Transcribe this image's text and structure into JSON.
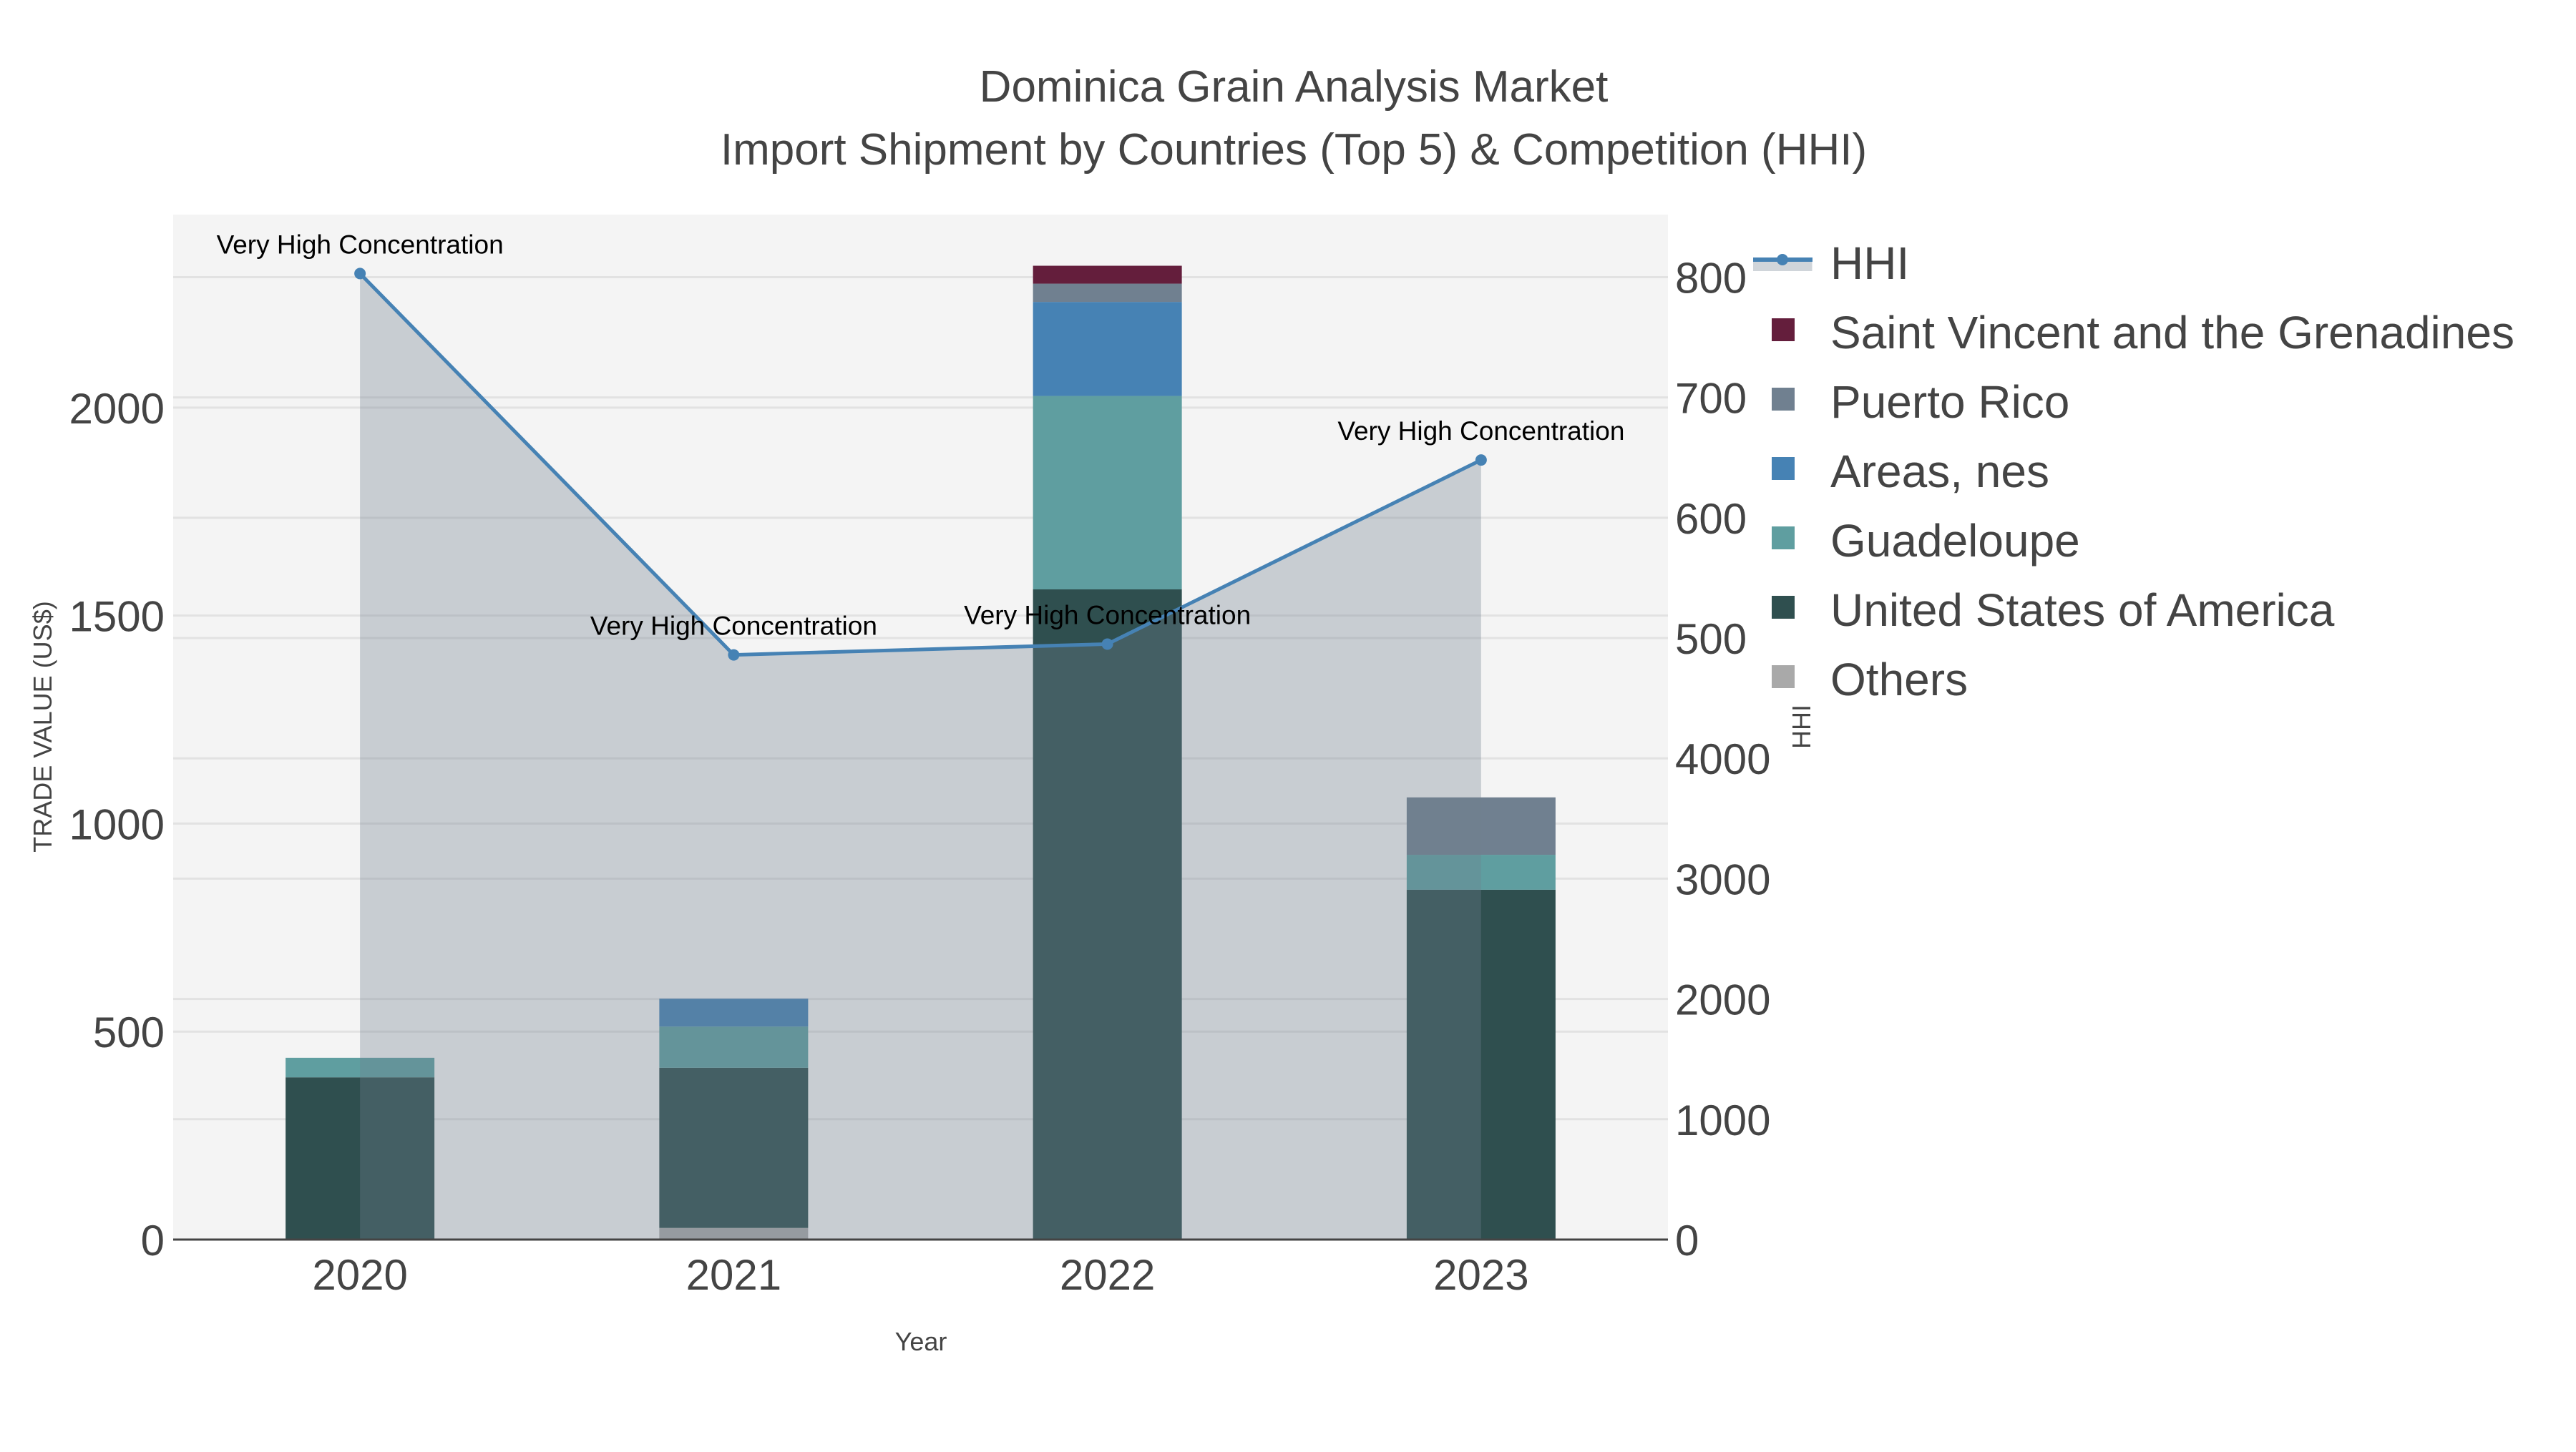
{
  "chart_data": {
    "type": "bar",
    "title": "Dominica Grain Analysis Market",
    "subtitle": "Import Shipment by Countries (Top 5) & Competition (HHI)",
    "xlabel": "Year",
    "ylabel": "TRADE VALUE (US$)",
    "y2label": "HHI",
    "categories": [
      "2020",
      "2021",
      "2022",
      "2023"
    ],
    "ylim": [
      0,
      2464
    ],
    "y2lim": [
      0,
      8520
    ],
    "yticks": [
      0,
      500,
      1000,
      1500,
      2000
    ],
    "y2ticks": [
      0,
      1000,
      2000,
      3000,
      4000,
      5000,
      6000,
      7000,
      8000
    ],
    "y2tick_labels": [
      "0",
      "1000",
      "2000",
      "3000",
      "4000",
      "500",
      "600",
      "700",
      "800"
    ],
    "series": [
      {
        "name": "Others",
        "color": "#A9A9A9",
        "values": [
          0,
          28,
          0,
          0
        ]
      },
      {
        "name": "United States of America",
        "color": "#2F4F4F",
        "values": [
          390,
          385,
          1563,
          841
        ]
      },
      {
        "name": "Guadeloupe",
        "color": "#5F9EA0",
        "values": [
          47,
          99,
          465,
          84
        ]
      },
      {
        "name": "Areas, nes",
        "color": "#4682B4",
        "values": [
          0,
          67,
          226,
          0
        ]
      },
      {
        "name": "Puerto Rico",
        "color": "#708090",
        "values": [
          0,
          0,
          44,
          138
        ]
      },
      {
        "name": "Saint Vincent and the Grenadines",
        "color": "#641E3C",
        "values": [
          0,
          0,
          43,
          0
        ]
      }
    ],
    "hhi": {
      "name": "HHI",
      "color": "#4682B4",
      "values": [
        8030,
        4860,
        4950,
        6480
      ]
    },
    "annotations": [
      "Very High Concentration",
      "Very High Concentration",
      "Very High Concentration",
      "Very High Concentration"
    ],
    "legend_order": [
      "HHI",
      "Saint Vincent and the Grenadines",
      "Puerto Rico",
      "Areas, nes",
      "Guadeloupe",
      "United States of America",
      "Others"
    ],
    "legend_position": "right",
    "grid": true
  }
}
